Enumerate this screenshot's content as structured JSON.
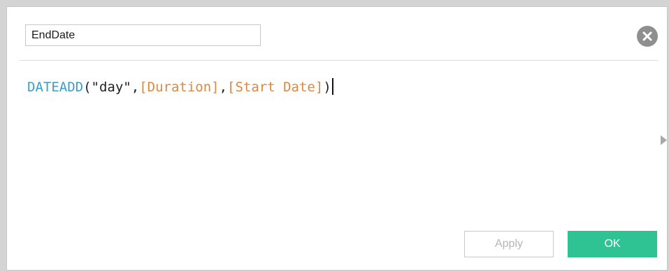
{
  "calculation": {
    "name_value": "EndDate",
    "formula_tokens": {
      "function": "DATEADD",
      "open_paren": "(",
      "string_arg": "\"day\"",
      "comma1": ",",
      "field1": "[Duration]",
      "comma2": ",",
      "field2": "[Start Date]",
      "close_paren": ")"
    }
  },
  "icons": {
    "close": "close-circle-icon",
    "expand": "triangle-right-icon"
  },
  "buttons": {
    "apply_label": "Apply",
    "ok_label": "OK"
  },
  "colors": {
    "function": "#3b9ec9",
    "field": "#e0873f",
    "ok_button": "#2fc394",
    "apply_disabled_text": "#b5b5b5"
  }
}
